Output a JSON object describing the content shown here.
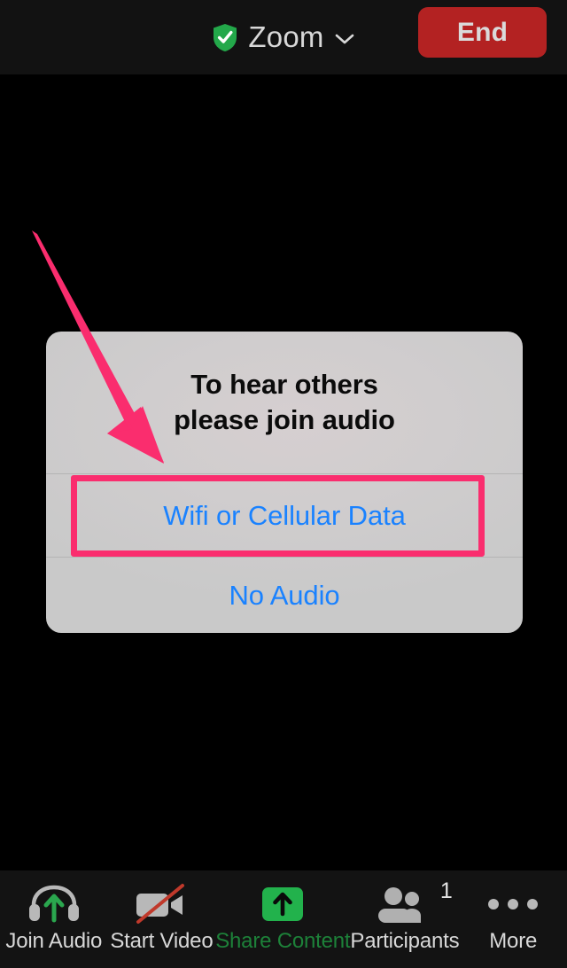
{
  "topbar": {
    "security_icon": "shield-check-icon",
    "title": "Zoom",
    "dropdown_icon": "chevron-down-icon",
    "end_label": "End",
    "end_color": "#b32222"
  },
  "dialog": {
    "message_line1": "To hear others",
    "message_line2": "please join audio",
    "options": [
      {
        "label": "Wifi or Cellular Data",
        "name": "wifi-or-cellular-data-option",
        "highlighted": true
      },
      {
        "label": "No Audio",
        "name": "no-audio-option",
        "highlighted": false
      }
    ],
    "link_color": "#1a82ff"
  },
  "annotation": {
    "highlight_color": "#fa2d6e",
    "arrow_icon": "down-right-arrow-annotation",
    "target": "Wifi or Cellular Data"
  },
  "toolbar": {
    "items": [
      {
        "label": "Join Audio",
        "icon": "headphones-join-audio-icon",
        "label_color": "#d8d8d8"
      },
      {
        "label": "Start Video",
        "icon": "video-camera-off-icon",
        "label_color": "#d8d8d8"
      },
      {
        "label": "Share Content",
        "icon": "share-content-up-arrow-icon",
        "label_color": "#1d8139"
      },
      {
        "label": "Participants",
        "icon": "participants-people-icon",
        "label_color": "#d8d8d8",
        "badge": "1"
      },
      {
        "label": "More",
        "icon": "more-ellipsis-icon",
        "label_color": "#d8d8d8"
      }
    ]
  }
}
